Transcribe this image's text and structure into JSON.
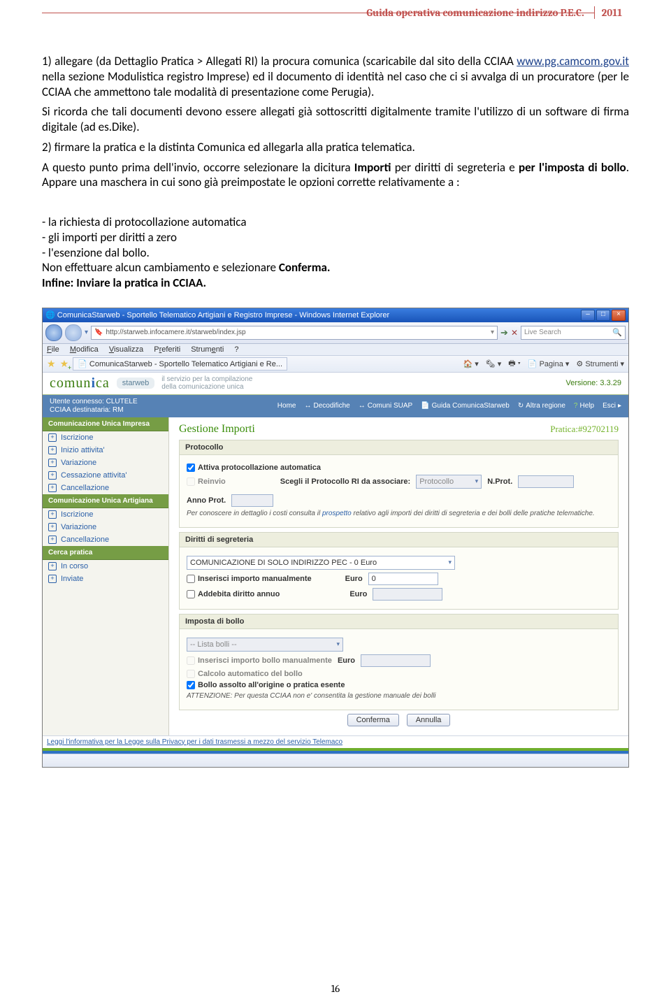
{
  "doc_header": {
    "title": "Guida operativa comunicazione indirizzo P.E.C.",
    "year": "2011"
  },
  "body": {
    "p1_a": "1) allegare (da Dettaglio Pratica > Allegati RI) la procura comunica (scaricabile dal sito della CCIAA ",
    "p1_link": "www.pg.camcom.gov.it",
    "p1_b": " nella sezione Modulistica registro Imprese) ed il documento di identità nel caso che ci si avvalga di un procuratore (per le CCIAA che ammettono tale modalità di presentazione come Perugia).",
    "p2": "Si ricorda che tali documenti devono essere allegati già sottoscritti digitalmente tramite l'utilizzo di un software di firma digitale (ad es.Dike).",
    "p3": "2) firmare la pratica e la distinta Comunica ed allegarla alla pratica telematica.",
    "p4_a": "A questo punto prima dell'invio, occorre selezionare la dicitura ",
    "p4_bold": "Importi",
    "p4_b": " per diritti di segreteria e ",
    "p4_bold2": "per l'imposta di bollo",
    "p4_c": ". Appare una maschera in cui sono già preimpostate le opzioni corrette relativamente a :",
    "li1": "- la richiesta di protocollazione automatica",
    "li2": "- gli importi per diritti a zero",
    "li3": "- l'esenzione dal bollo.",
    "p5_a": "Non effettuare alcun cambiamento e selezionare ",
    "p5_bold": "Conferma.",
    "p6": "Infine: Inviare la pratica in CCIAA."
  },
  "ie": {
    "title": "ComunicaStarweb - Sportello Telematico Artigiani e Registro Imprese - Windows Internet Explorer",
    "url": "http://starweb.infocamere.it/starweb/index.jsp",
    "search_placeholder": "Live Search",
    "menu": {
      "file": "File",
      "mod": "Modifica",
      "vis": "Visualizza",
      "pref": "Preferiti",
      "str": "Strumenti",
      "q": "?"
    },
    "tab": "ComunicaStarweb - Sportello Telematico Artigiani e Re...",
    "tools": {
      "pagina": "Pagina",
      "strumenti": "Strumenti"
    }
  },
  "app": {
    "logo_a": "comun",
    "logo_i": "i",
    "logo_b": "ca",
    "starweb": "starweb",
    "slogan1": "il servizio per la compilazione",
    "slogan2": "della comunicazione unica",
    "version": "Versione: 3.3.29",
    "user_a": "Utente connesso: CLUTELE",
    "user_b": "CCIAA destinataria: RM",
    "nav": {
      "home": "Home",
      "decod": "Decodifiche",
      "comuni": "Comuni SUAP",
      "guida": "Guida ComunicaStarweb",
      "regione": "Altra regione",
      "help": "Help",
      "esci": "Esci"
    }
  },
  "sidebar": {
    "s1": "Comunicazione Unica Impresa",
    "i1": [
      "Iscrizione",
      "Inizio attivita'",
      "Variazione",
      "Cessazione attivita'",
      "Cancellazione"
    ],
    "s2": "Comunicazione Unica Artigiana",
    "i2": [
      "Iscrizione",
      "Variazione",
      "Cancellazione"
    ],
    "s3": "Cerca pratica",
    "i3": [
      "In corso",
      "Inviate"
    ]
  },
  "main": {
    "title": "Gestione Importi",
    "pratica_lbl": "Pratica:#",
    "pratica_num": "92702119",
    "prot": {
      "hdr": "Protocollo",
      "attiva": "Attiva protocollazione automatica",
      "reinvio": "Reinvio",
      "scegli": "Scegli il Protocollo RI da associare:",
      "proto_sel": "Protocollo",
      "nprot": "N.Prot.",
      "annoprot": "Anno Prot.",
      "note_a": "Per conoscere in dettaglio i costi consulta il ",
      "note_link": "prospetto",
      "note_b": " relativo agli importi dei diritti di segreteria e dei bolli delle pratiche telematiche."
    },
    "seg": {
      "hdr": "Diritti di segreteria",
      "sel": "COMUNICAZIONE DI SOLO INDIRIZZO PEC - 0 Euro",
      "man": "Inserisci importo manualmente",
      "euro": "Euro",
      "euro_val": "0",
      "annuo": "Addebita diritto annuo"
    },
    "bollo": {
      "hdr": "Imposta di bollo",
      "lista": "-- Lista bolli --",
      "man": "Inserisci importo bollo manualmente",
      "euro": "Euro",
      "calc": "Calcolo automatico del bollo",
      "origine": "Bollo assolto all'origine o pratica esente",
      "warn": "ATTENZIONE: Per questa CCIAA non e' consentita la gestione manuale dei bolli"
    },
    "btn_conf": "Conferma",
    "btn_ann": "Annulla",
    "privacy": "Leggi l'informativa per la Legge sulla Privacy per i dati trasmessi a mezzo del servizio Telemaco"
  },
  "page_num": "16"
}
